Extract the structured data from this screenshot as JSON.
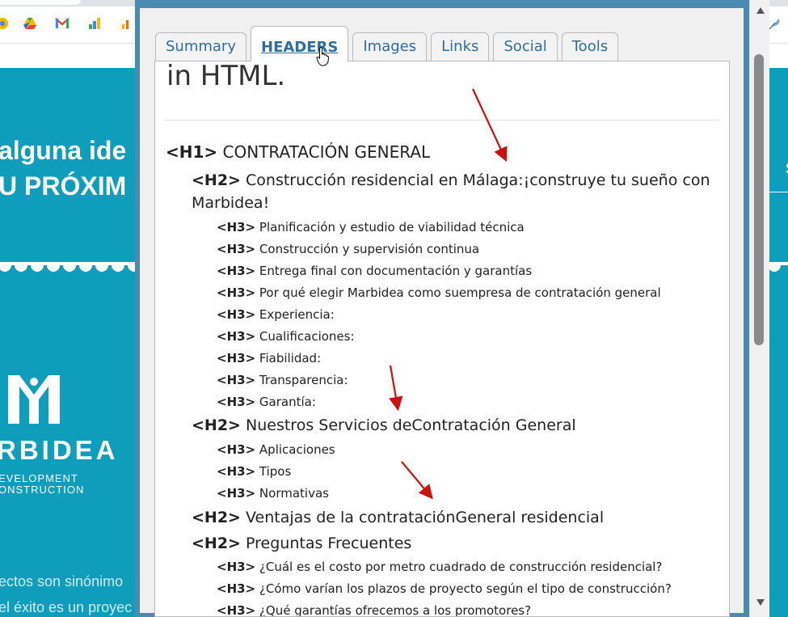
{
  "website": {
    "hero_line_1": "alguna ide",
    "hero_line_2": "U PRÓXIM",
    "brand": "RBIDEA",
    "tagline_1": "EVELOPMENT",
    "tagline_2": "ONSTRUCTION",
    "body_line_1": "ectos son sinónimo",
    "body_line_2": "el éxito es un proyec"
  },
  "colors": {
    "site_bg": "#0e9dbb",
    "popup_frame": "#4b8ab0",
    "tab_text": "#2f6e9a",
    "arrow": "#cc1111"
  },
  "tabs": [
    {
      "label": "Summary"
    },
    {
      "label": "HEADERS"
    },
    {
      "label": "Images"
    },
    {
      "label": "Links"
    },
    {
      "label": "Social"
    },
    {
      "label": "Tools"
    }
  ],
  "content": {
    "top_text": "in HTML.",
    "headings": [
      {
        "tag": "<H1>",
        "text": "CONTRATACIÓN GENERAL"
      },
      {
        "tag": "<H2>",
        "text": "Construcción residencial en Málaga:¡construye tu sueño con"
      },
      {
        "tag": "",
        "text": "Marbidea!"
      },
      {
        "tag": "<H3>",
        "text": "Planificación y estudio de viabilidad técnica"
      },
      {
        "tag": "<H3>",
        "text": "Construcción y supervisión continua"
      },
      {
        "tag": "<H3>",
        "text": "Entrega final con documentación y garantías"
      },
      {
        "tag": "<H3>",
        "text": "Por qué elegir Marbidea como suempresa de contratación general"
      },
      {
        "tag": "<H3>",
        "text": "Experiencia:"
      },
      {
        "tag": "<H3>",
        "text": "Cualificaciones:"
      },
      {
        "tag": "<H3>",
        "text": "Fiabilidad:"
      },
      {
        "tag": "<H3>",
        "text": "Transparencia:"
      },
      {
        "tag": "<H3>",
        "text": "Garantía:"
      },
      {
        "tag": "<H2>",
        "text": "Nuestros Servicios deContratación General"
      },
      {
        "tag": "<H3>",
        "text": "Aplicaciones"
      },
      {
        "tag": "<H3>",
        "text": "Tipos"
      },
      {
        "tag": "<H3>",
        "text": "Normativas"
      },
      {
        "tag": "<H2>",
        "text": "Ventajas de la contrataciónGeneral residencial"
      },
      {
        "tag": "<H2>",
        "text": "Preguntas Frecuentes"
      },
      {
        "tag": "<H3>",
        "text": "¿Cuál es el costo por metro cuadrado de construcción residencial?"
      },
      {
        "tag": "<H3>",
        "text": "¿Cómo varían los plazos de proyecto según el tipo de construcción?"
      },
      {
        "tag": "<H3>",
        "text": "¿Qué garantías ofrecemos a los promotores?"
      }
    ]
  }
}
